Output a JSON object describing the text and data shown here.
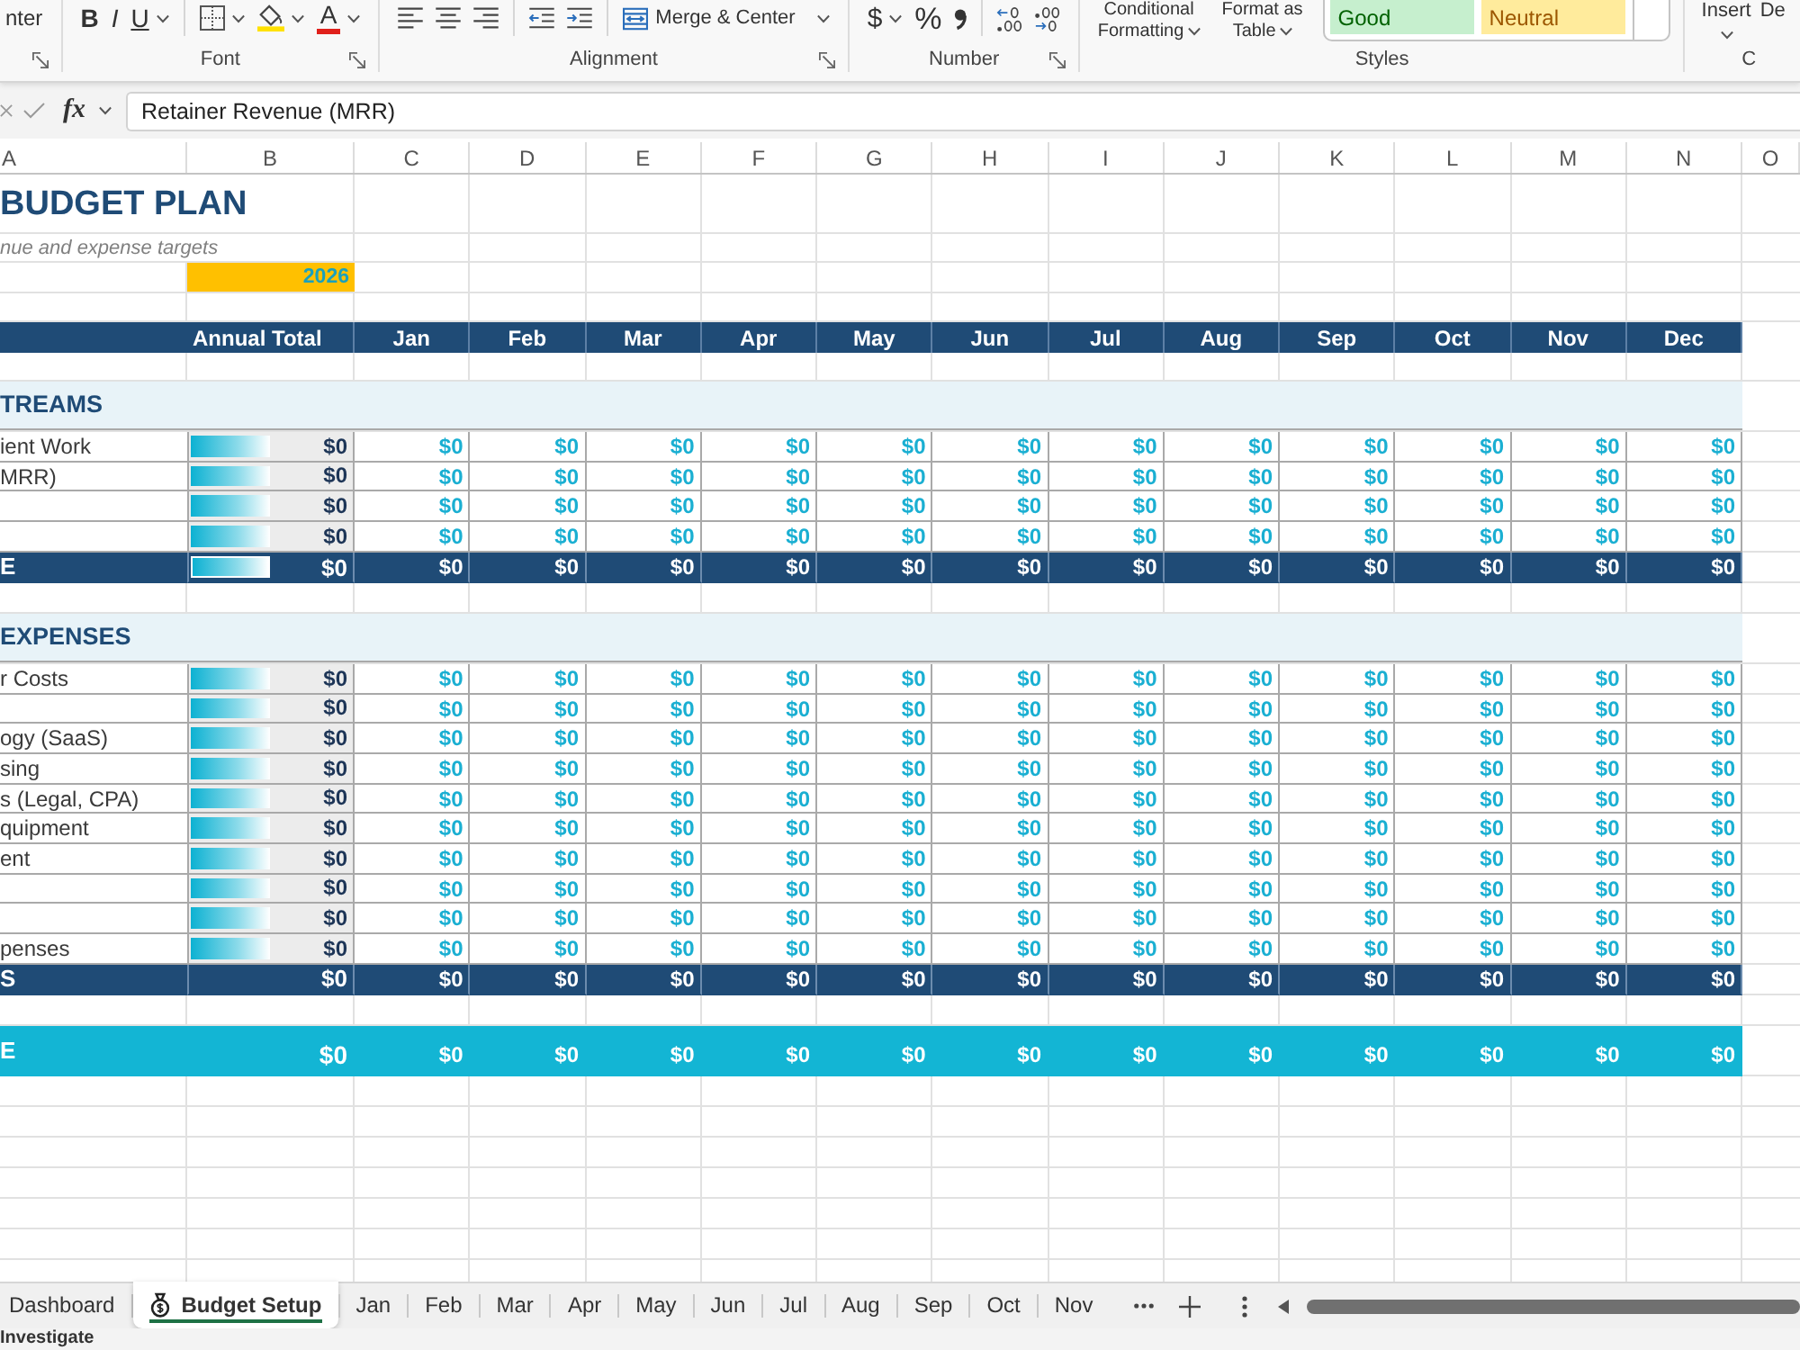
{
  "ribbon": {
    "groups": [
      {
        "items": [
          {
            "kind": "text",
            "label": "nter",
            "dropdown": false
          }
        ],
        "launcher": true
      },
      {
        "label": "Font",
        "launcher": true,
        "items": [
          {
            "kind": "bold",
            "label": "B",
            "dropdown": false
          },
          {
            "kind": "italic",
            "label": "I",
            "dropdown": false
          },
          {
            "kind": "underline",
            "label": "U",
            "dropdown": true
          },
          {
            "kind": "separator"
          },
          {
            "kind": "borders",
            "dropdown": true
          },
          {
            "kind": "fill_color",
            "dropdown": true
          },
          {
            "kind": "font_color",
            "label": "A",
            "dropdown": true
          }
        ]
      },
      {
        "label": "Alignment",
        "launcher": true,
        "items": [
          {
            "kind": "align_left",
            "dropdown": false
          },
          {
            "kind": "align_center",
            "dropdown": false
          },
          {
            "kind": "align_right",
            "dropdown": false
          },
          {
            "kind": "separator"
          },
          {
            "kind": "outdent",
            "dropdown": false
          },
          {
            "kind": "indent",
            "dropdown": false
          },
          {
            "kind": "separator"
          },
          {
            "kind": "merge",
            "label": "Merge & Center",
            "dropdown": true
          }
        ]
      },
      {
        "label": "Number",
        "launcher": true,
        "items": [
          {
            "kind": "currency",
            "label": "$",
            "dropdown": true
          },
          {
            "kind": "percent",
            "label": "%",
            "dropdown": false
          },
          {
            "kind": "comma",
            "dropdown": false
          },
          {
            "kind": "separator"
          },
          {
            "kind": "increase_decimal",
            "dropdown": false
          },
          {
            "kind": "decrease_decimal",
            "dropdown": false
          }
        ]
      },
      {
        "label": "Styles",
        "launcher": false,
        "items": [
          {
            "kind": "big_command",
            "label": "Conditional Formatting",
            "dropdown": true
          },
          {
            "kind": "big_command",
            "label": "Format as Table",
            "dropdown": true
          },
          {
            "kind": "gallery",
            "styles": [
              {
                "kind": "good",
                "label": "Good"
              },
              {
                "kind": "neutral",
                "label": "Neutral"
              }
            ]
          }
        ]
      },
      {
        "label": "C",
        "launcher": false,
        "items": [
          {
            "kind": "stacked_command",
            "label": "Insert",
            "dropdown": true
          },
          {
            "kind": "stacked_command",
            "label": "De",
            "dropdown": false
          }
        ]
      }
    ]
  },
  "formula_bar": {
    "function_label": "fx",
    "value": "Retainer Revenue (MRR)"
  },
  "columns": [
    "A",
    "B",
    "C",
    "D",
    "E",
    "F",
    "G",
    "H",
    "I",
    "J",
    "K",
    "L",
    "M",
    "N",
    "O"
  ],
  "sheet": {
    "title": "BUDGET PLAN",
    "subtitle": "nue and expense targets",
    "year": "2026",
    "header": {
      "total": "Annual Total",
      "months": [
        "Jan",
        "Feb",
        "Mar",
        "Apr",
        "May",
        "Jun",
        "Jul",
        "Aug",
        "Sep",
        "Oct",
        "Nov",
        "Dec"
      ]
    },
    "sections": [
      {
        "title": "TREAMS",
        "rows": [
          {
            "label": "ient Work",
            "level": 0.5,
            "total": "$0",
            "months": [
              "$0",
              "$0",
              "$0",
              "$0",
              "$0",
              "$0",
              "$0",
              "$0",
              "$0",
              "$0",
              "$0",
              "$0"
            ]
          },
          {
            "label": "MRR)",
            "level": 0.5,
            "total": "$0",
            "months": [
              "$0",
              "$0",
              "$0",
              "$0",
              "$0",
              "$0",
              "$0",
              "$0",
              "$0",
              "$0",
              "$0",
              "$0"
            ]
          },
          {
            "level": 0.5,
            "total": "$0",
            "months": [
              "$0",
              "$0",
              "$0",
              "$0",
              "$0",
              "$0",
              "$0",
              "$0",
              "$0",
              "$0",
              "$0",
              "$0"
            ]
          },
          {
            "level": 0.5,
            "total": "$0",
            "months": [
              "$0",
              "$0",
              "$0",
              "$0",
              "$0",
              "$0",
              "$0",
              "$0",
              "$0",
              "$0",
              "$0",
              "$0"
            ]
          }
        ],
        "total_row": {
          "label": "E",
          "level": 0.5,
          "total": "$0",
          "months": [
            "$0",
            "$0",
            "$0",
            "$0",
            "$0",
            "$0",
            "$0",
            "$0",
            "$0",
            "$0",
            "$0",
            "$0"
          ]
        }
      },
      {
        "title": "EXPENSES",
        "rows": [
          {
            "label": "r Costs",
            "level": 0.5,
            "total": "$0",
            "months": [
              "$0",
              "$0",
              "$0",
              "$0",
              "$0",
              "$0",
              "$0",
              "$0",
              "$0",
              "$0",
              "$0",
              "$0"
            ]
          },
          {
            "level": 0.5,
            "total": "$0",
            "months": [
              "$0",
              "$0",
              "$0",
              "$0",
              "$0",
              "$0",
              "$0",
              "$0",
              "$0",
              "$0",
              "$0",
              "$0"
            ]
          },
          {
            "label": "ogy (SaaS)",
            "level": 0.5,
            "total": "$0",
            "months": [
              "$0",
              "$0",
              "$0",
              "$0",
              "$0",
              "$0",
              "$0",
              "$0",
              "$0",
              "$0",
              "$0",
              "$0"
            ]
          },
          {
            "label": "sing",
            "level": 0.5,
            "total": "$0",
            "months": [
              "$0",
              "$0",
              "$0",
              "$0",
              "$0",
              "$0",
              "$0",
              "$0",
              "$0",
              "$0",
              "$0",
              "$0"
            ]
          },
          {
            "label": "s (Legal, CPA)",
            "level": 0.5,
            "total": "$0",
            "months": [
              "$0",
              "$0",
              "$0",
              "$0",
              "$0",
              "$0",
              "$0",
              "$0",
              "$0",
              "$0",
              "$0",
              "$0"
            ]
          },
          {
            "label": "quipment",
            "level": 0.5,
            "total": "$0",
            "months": [
              "$0",
              "$0",
              "$0",
              "$0",
              "$0",
              "$0",
              "$0",
              "$0",
              "$0",
              "$0",
              "$0",
              "$0"
            ]
          },
          {
            "label": "ent",
            "level": 0.5,
            "total": "$0",
            "months": [
              "$0",
              "$0",
              "$0",
              "$0",
              "$0",
              "$0",
              "$0",
              "$0",
              "$0",
              "$0",
              "$0",
              "$0"
            ]
          },
          {
            "level": 0.5,
            "total": "$0",
            "months": [
              "$0",
              "$0",
              "$0",
              "$0",
              "$0",
              "$0",
              "$0",
              "$0",
              "$0",
              "$0",
              "$0",
              "$0"
            ]
          },
          {
            "level": 0.5,
            "total": "$0",
            "months": [
              "$0",
              "$0",
              "$0",
              "$0",
              "$0",
              "$0",
              "$0",
              "$0",
              "$0",
              "$0",
              "$0",
              "$0"
            ]
          },
          {
            "label": "penses",
            "level": 0.5,
            "total": "$0",
            "months": [
              "$0",
              "$0",
              "$0",
              "$0",
              "$0",
              "$0",
              "$0",
              "$0",
              "$0",
              "$0",
              "$0",
              "$0"
            ]
          }
        ],
        "total_row": {
          "label": "S",
          "total": "$0",
          "months": [
            "$0",
            "$0",
            "$0",
            "$0",
            "$0",
            "$0",
            "$0",
            "$0",
            "$0",
            "$0",
            "$0",
            "$0"
          ]
        }
      }
    ],
    "net_row": {
      "label": "E",
      "total": "$0",
      "months": [
        "$0",
        "$0",
        "$0",
        "$0",
        "$0",
        "$0",
        "$0",
        "$0",
        "$0",
        "$0",
        "$0",
        "$0"
      ]
    }
  },
  "sheet_tabs": [
    {
      "label": "Dashboard",
      "selected": false,
      "icon": false
    },
    {
      "label": "Budget Setup",
      "selected": true,
      "icon": true
    },
    {
      "label": "Jan",
      "selected": false,
      "icon": false
    },
    {
      "label": "Feb",
      "selected": false,
      "icon": false
    },
    {
      "label": "Mar",
      "selected": false,
      "icon": false
    },
    {
      "label": "Apr",
      "selected": false,
      "icon": false
    },
    {
      "label": "May",
      "selected": false,
      "icon": false
    },
    {
      "label": "Jun",
      "selected": false,
      "icon": false
    },
    {
      "label": "Jul",
      "selected": false,
      "icon": false
    },
    {
      "label": "Aug",
      "selected": false,
      "icon": false
    },
    {
      "label": "Sep",
      "selected": false,
      "icon": false
    },
    {
      "label": "Oct",
      "selected": false,
      "icon": false
    },
    {
      "label": "Nov",
      "selected": false,
      "icon": false
    }
  ],
  "status_bar": {
    "text": "Investigate"
  }
}
